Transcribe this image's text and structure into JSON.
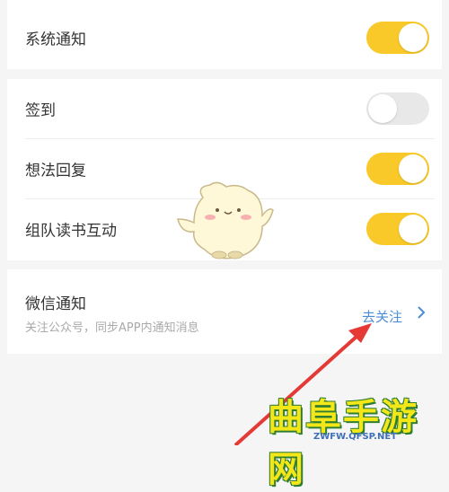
{
  "settings": {
    "items": [
      {
        "label": "系统通知",
        "enabled": true
      },
      {
        "label": "签到",
        "enabled": false
      },
      {
        "label": "想法回复",
        "enabled": true
      },
      {
        "label": "组队读书互动",
        "enabled": true
      }
    ]
  },
  "wechat": {
    "title": "微信通知",
    "subtitle": "关注公众号，同步APP内通知消息",
    "action_label": "去关注"
  },
  "watermark": {
    "text": "曲阜手游网",
    "url": "ZWFW.QFSP.NET"
  },
  "colors": {
    "toggle_on": "#f8c928",
    "toggle_off": "#e8e8e8",
    "link": "#4b8ed8",
    "arrow": "#e53935"
  }
}
